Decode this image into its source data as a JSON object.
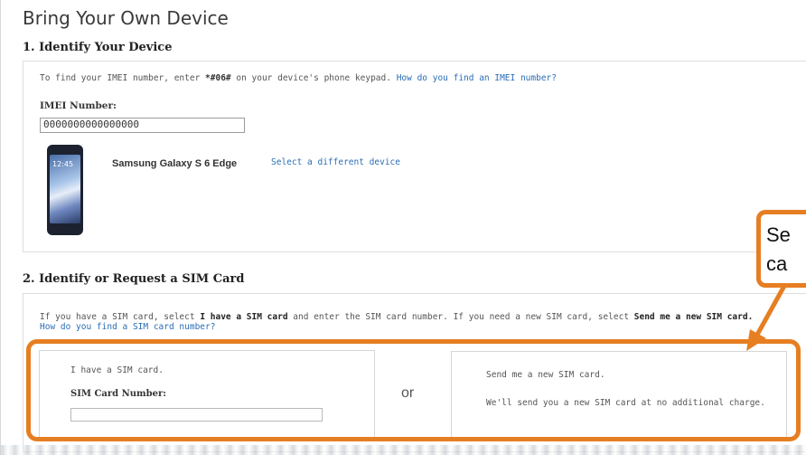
{
  "page": {
    "title": "Bring Your Own Device"
  },
  "section1": {
    "heading": "1. Identify Your Device",
    "instruction_prefix": "To find your IMEI number, enter ",
    "code": "*#06#",
    "instruction_suffix": " on your device's phone keypad.",
    "help_link": "How do you find an IMEI number?",
    "imei_label": "IMEI Number:",
    "imei_value": "0000000000000000",
    "device_name": "Samsung Galaxy S 6 Edge",
    "select_device_link": "Select a different device",
    "phone_screen_time": "12:45"
  },
  "section2": {
    "heading": "2. Identify or Request a SIM Card",
    "instruction_part1": "If you have a SIM card, select ",
    "instruction_bold1": "I have a SIM card",
    "instruction_part2": " and enter the SIM card number. If you need a new SIM card, select ",
    "instruction_bold2": "Send me a new SIM card.",
    "help_link": "How do you find a SIM card number?",
    "option_have": {
      "title": "I have a SIM card.",
      "label": "SIM Card Number:",
      "value": ""
    },
    "or_label": "or",
    "option_new": {
      "title": "Send me a new SIM card.",
      "description": "We'll send you a new SIM card at no additional charge."
    }
  },
  "callout": {
    "line1": "Se",
    "line2": "ca",
    "color": "#e67e22"
  }
}
